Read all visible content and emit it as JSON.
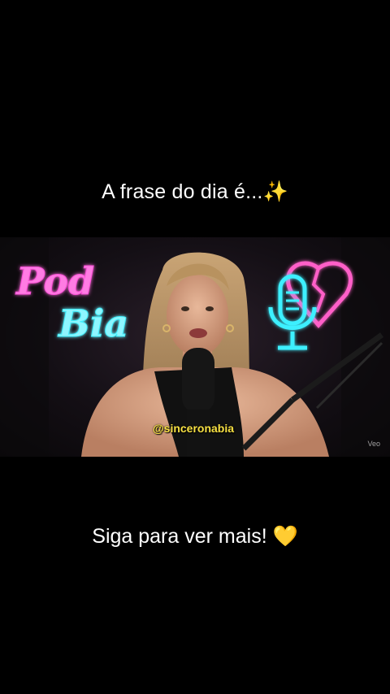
{
  "captions": {
    "top": "A frase do dia é...✨",
    "bottom": "Siga para ver mais! 💛"
  },
  "video": {
    "neon_sign_line1": "Pod",
    "neon_sign_line2": "Bia",
    "handle": "@sinceronabia",
    "watermark": "Veo"
  },
  "colors": {
    "background": "#000000",
    "neon_pink": "#ff4fd8",
    "neon_cyan": "#3ef0ff",
    "handle_yellow": "#f7e043"
  },
  "icons": [
    "microphone-neon-icon",
    "heart-neon-icon"
  ]
}
